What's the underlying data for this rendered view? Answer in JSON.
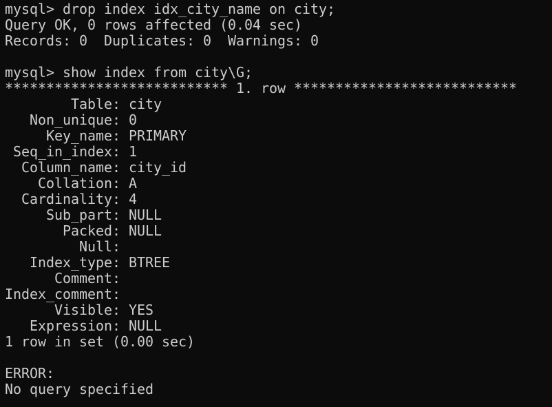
{
  "terminal": {
    "lines": [
      "mysql> drop index idx_city_name on city;",
      "Query OK, 0 rows affected (0.04 sec)",
      "Records: 0  Duplicates: 0  Warnings: 0",
      "",
      "mysql> show index from city\\G;",
      "*************************** 1. row ***************************",
      "        Table: city",
      "   Non_unique: 0",
      "     Key_name: PRIMARY",
      " Seq_in_index: 1",
      "  Column_name: city_id",
      "    Collation: A",
      "  Cardinality: 4",
      "     Sub_part: NULL",
      "       Packed: NULL",
      "         Null: ",
      "   Index_type: BTREE",
      "      Comment: ",
      "Index_comment: ",
      "      Visible: YES",
      "   Expression: NULL",
      "1 row in set (0.00 sec)",
      "",
      "ERROR:",
      "No query specified"
    ]
  }
}
